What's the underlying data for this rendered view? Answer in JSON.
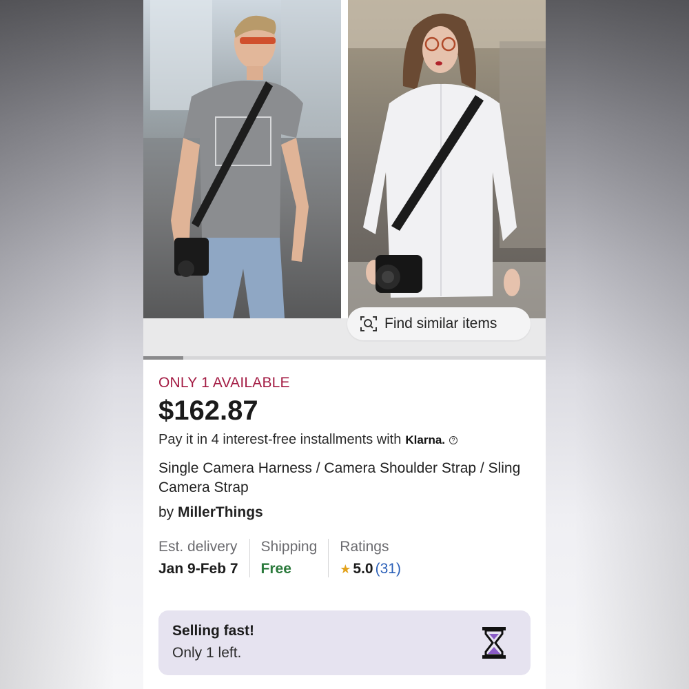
{
  "gallery": {
    "find_similar_label": "Find similar items",
    "find_similar_icon": "visual-search-icon",
    "progress_fraction": 0.1
  },
  "listing": {
    "availability": "ONLY 1 AVAILABLE",
    "price": "$162.87",
    "installments_text": "Pay it in 4 interest-free installments with",
    "installments_provider": "Klarna.",
    "title": "Single Camera Harness / Camera Shoulder Strap / Sling Camera Strap",
    "seller_prefix": "by",
    "seller_name": "MillerThings"
  },
  "meta": {
    "delivery_label": "Est. delivery",
    "delivery_value": "Jan 9-Feb 7",
    "shipping_label": "Shipping",
    "shipping_value": "Free",
    "ratings_label": "Ratings",
    "rating_value": "5.0",
    "rating_count": "(31)"
  },
  "selling_fast": {
    "title": "Selling fast!",
    "subtitle": "Only 1 left.",
    "icon": "hourglass-icon"
  },
  "colors": {
    "availability": "#a31b43",
    "shipping_free": "#2b7a3c",
    "star": "#e2a21c",
    "rating_count": "#2a5fb8",
    "selling_fast_bg": "#e6e3f0",
    "hourglass_fill": "#8a5cc6"
  }
}
